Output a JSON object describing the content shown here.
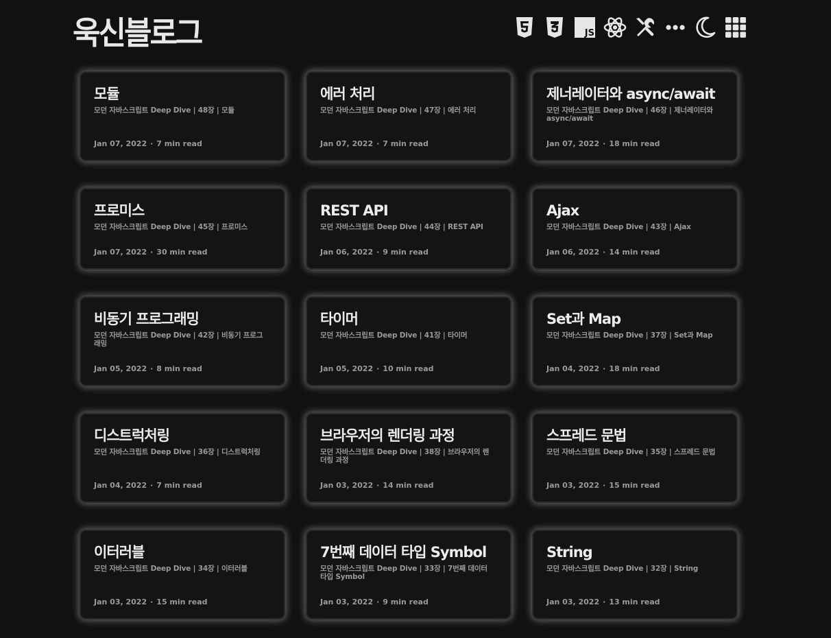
{
  "header": {
    "logo": "욱신블로그",
    "icons": [
      "html5-icon",
      "css3-icon",
      "javascript-icon",
      "react-icon",
      "tools-icon",
      "more-icon",
      "moon-icon",
      "grid-menu-icon"
    ],
    "js_badge": "JS"
  },
  "posts": [
    {
      "title": "모듈",
      "subtitle": "모던 자바스크립트 Deep Dive | 48장 | 모듈",
      "date": "Jan 07, 2022",
      "read": "7 min read"
    },
    {
      "title": "에러 처리",
      "subtitle": "모던 자바스크립트 Deep Dive | 47장 | 에러 처리",
      "date": "Jan 07, 2022",
      "read": "7 min read"
    },
    {
      "title": "제너레이터와 async/await",
      "subtitle": "모던 자바스크립트 Deep Dive | 46장 | 제너레이터와 async/await",
      "date": "Jan 07, 2022",
      "read": "18 min read"
    },
    {
      "title": "프로미스",
      "subtitle": "모던 자바스크립트 Deep Dive | 45장 | 프로미스",
      "date": "Jan 07, 2022",
      "read": "30 min read"
    },
    {
      "title": "REST API",
      "subtitle": "모던 자바스크립트 Deep Dive | 44장 | REST API",
      "date": "Jan 06, 2022",
      "read": "9 min read"
    },
    {
      "title": "Ajax",
      "subtitle": "모던 자바스크립트 Deep Dive | 43장 | Ajax",
      "date": "Jan 06, 2022",
      "read": "14 min read"
    },
    {
      "title": "비동기 프로그래밍",
      "subtitle": "모던 자바스크립트 Deep Dive | 42장 | 비동기 프로그래밍",
      "date": "Jan 05, 2022",
      "read": "8 min read"
    },
    {
      "title": "타이머",
      "subtitle": "모던 자바스크립트 Deep Dive | 41장 | 타이머",
      "date": "Jan 05, 2022",
      "read": "10 min read"
    },
    {
      "title": "Set과 Map",
      "subtitle": "모던 자바스크립트 Deep Dive | 37장 | Set과 Map",
      "date": "Jan 04, 2022",
      "read": "18 min read"
    },
    {
      "title": "디스트럭처링",
      "subtitle": "모던 자바스크립트 Deep Dive | 36장 | 디스트럭처링",
      "date": "Jan 04, 2022",
      "read": "7 min read"
    },
    {
      "title": "브라우저의 렌더링 과정",
      "subtitle": "모던 자바스크립트 Deep Dive | 38장 | 브라우저의 렌더링 과정",
      "date": "Jan 03, 2022",
      "read": "14 min read"
    },
    {
      "title": "스프레드 문법",
      "subtitle": "모던 자바스크립트 Deep Dive | 35장 | 스프레드 문법",
      "date": "Jan 03, 2022",
      "read": "15 min read"
    },
    {
      "title": "이터러블",
      "subtitle": "모던 자바스크립트 Deep Dive | 34장 | 이터러블",
      "date": "Jan 03, 2022",
      "read": "15 min read"
    },
    {
      "title": "7번째 데이터 타입 Symbol",
      "subtitle": "모던 자바스크립트 Deep Dive | 33장 | 7번째 데이터 타입 Symbol",
      "date": "Jan 03, 2022",
      "read": "9 min read"
    },
    {
      "title": "String",
      "subtitle": "모던 자바스크립트 Deep Dive | 32장 | String",
      "date": "Jan 03, 2022",
      "read": "13 min read"
    }
  ],
  "meta_separator": "·"
}
